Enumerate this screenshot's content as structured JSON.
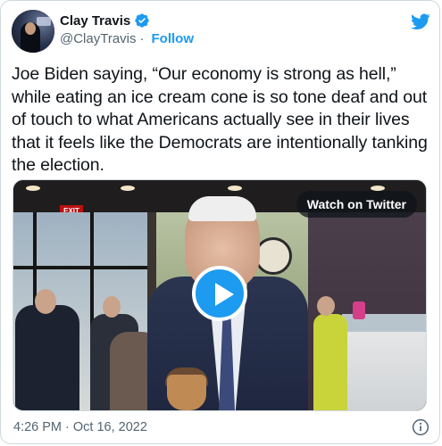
{
  "author": {
    "name": "Clay Travis",
    "handle": "@ClayTravis",
    "separator": "·",
    "follow_label": "Follow",
    "verified": true
  },
  "tweet": {
    "text": "Joe Biden saying, “Our economy is strong as hell,” while eating an ice cream cone is so tone deaf and out of touch to what Americans actually see in their lives that it feels like the Democrats are intentionally tanking the election."
  },
  "media": {
    "watch_label": "Watch on Twitter",
    "exit_sign": "EXIT"
  },
  "footer": {
    "timestamp": "4:26 PM · Oct 16, 2022"
  },
  "colors": {
    "brand_blue": "#1d9bf0",
    "text_primary": "#0f1419",
    "text_secondary": "#536471",
    "border": "#cfd9de"
  },
  "icons": {
    "verified": "verified-badge-icon",
    "platform": "twitter-bird-icon",
    "play": "play-icon",
    "info": "info-icon"
  }
}
